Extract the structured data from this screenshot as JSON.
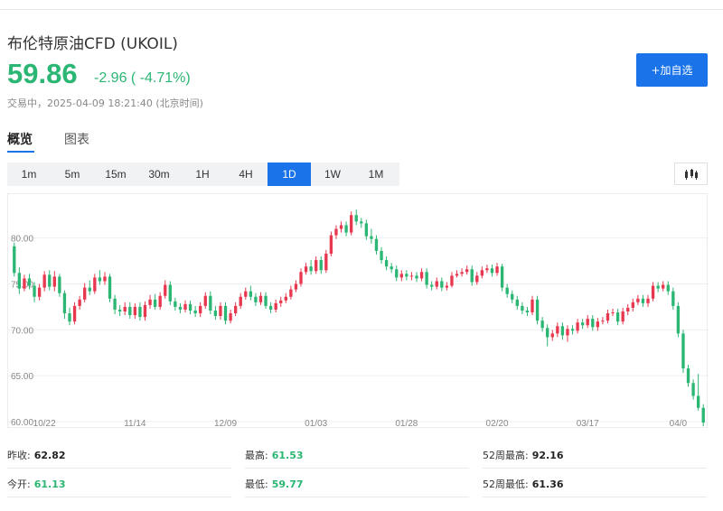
{
  "header": {
    "title": "布伦特原油CFD (UKOIL)",
    "price": "59.86",
    "change": "-2.96 ( -4.71%)",
    "status": "交易中，2025-04-09 18:21:40 (北京时间)",
    "add_watchlist": "+加自选"
  },
  "tabs": [
    {
      "label": "概览",
      "active": true
    },
    {
      "label": "图表",
      "active": false
    }
  ],
  "ranges": [
    {
      "label": "1m",
      "active": false
    },
    {
      "label": "5m",
      "active": false
    },
    {
      "label": "15m",
      "active": false
    },
    {
      "label": "30m",
      "active": false
    },
    {
      "label": "1H",
      "active": false
    },
    {
      "label": "4H",
      "active": false
    },
    {
      "label": "1D",
      "active": true
    },
    {
      "label": "1W",
      "active": false
    },
    {
      "label": "1M",
      "active": false
    }
  ],
  "chart_type_icon": "candlestick-icon",
  "chart_data": {
    "type": "candlestick",
    "ylim": [
      60,
      84
    ],
    "y_ticks": [
      "80.00",
      "75.00",
      "70.00",
      "65.00",
      "60.00"
    ],
    "y_tick_values": [
      80,
      75,
      70,
      65,
      60
    ],
    "x_labels": [
      "10/22",
      "11/14",
      "12/09",
      "01/03",
      "01/28",
      "02/20",
      "03/17",
      "04/0"
    ],
    "x_label_index": [
      6,
      24,
      42,
      60,
      78,
      96,
      114,
      132
    ],
    "up_color": "#e8384f",
    "down_color": "#2bb673",
    "candles": [
      [
        79.1,
        76.2,
        79.5,
        75.8
      ],
      [
        76.2,
        74.5,
        76.8,
        73.9
      ],
      [
        74.5,
        75.6,
        76.0,
        74.2
      ],
      [
        75.6,
        74.8,
        76.1,
        74.4
      ],
      [
        74.8,
        73.6,
        75.2,
        73.0
      ],
      [
        73.6,
        74.6,
        75.0,
        73.2
      ],
      [
        74.6,
        76.0,
        76.4,
        74.2
      ],
      [
        76.0,
        74.7,
        76.5,
        74.3
      ],
      [
        74.7,
        75.8,
        76.4,
        74.2
      ],
      [
        75.8,
        74.0,
        76.1,
        73.6
      ],
      [
        74.0,
        71.8,
        74.3,
        71.2
      ],
      [
        71.8,
        70.9,
        72.4,
        70.5
      ],
      [
        70.9,
        72.6,
        73.0,
        70.6
      ],
      [
        72.6,
        73.3,
        73.7,
        72.2
      ],
      [
        73.3,
        74.6,
        75.1,
        73.0
      ],
      [
        74.6,
        74.2,
        75.4,
        73.8
      ],
      [
        74.2,
        75.7,
        76.1,
        73.9
      ],
      [
        75.7,
        75.3,
        76.5,
        74.9
      ],
      [
        75.3,
        75.8,
        76.3,
        74.9
      ],
      [
        75.8,
        73.4,
        76.1,
        73.0
      ],
      [
        73.4,
        72.2,
        73.8,
        71.7
      ],
      [
        72.2,
        72.0,
        72.7,
        71.5
      ],
      [
        72.0,
        72.5,
        73.0,
        71.6
      ],
      [
        72.5,
        71.6,
        73.0,
        71.2
      ],
      [
        71.6,
        72.5,
        72.9,
        71.2
      ],
      [
        72.5,
        71.4,
        73.0,
        71.0
      ],
      [
        71.4,
        72.7,
        73.1,
        71.0
      ],
      [
        72.7,
        73.3,
        73.8,
        72.3
      ],
      [
        73.3,
        72.5,
        73.9,
        72.2
      ],
      [
        72.5,
        73.7,
        74.1,
        72.2
      ],
      [
        73.7,
        74.9,
        75.4,
        73.4
      ],
      [
        74.9,
        73.1,
        75.3,
        72.7
      ],
      [
        73.1,
        72.5,
        73.5,
        72.1
      ],
      [
        72.5,
        72.2,
        72.9,
        71.8
      ],
      [
        72.2,
        72.8,
        73.2,
        71.9
      ],
      [
        72.8,
        72.1,
        73.2,
        71.7
      ],
      [
        72.1,
        71.8,
        72.6,
        71.4
      ],
      [
        71.8,
        72.6,
        73.0,
        71.4
      ],
      [
        72.6,
        73.7,
        74.1,
        72.3
      ],
      [
        73.7,
        72.1,
        74.2,
        71.7
      ],
      [
        72.1,
        71.5,
        72.6,
        71.1
      ],
      [
        71.5,
        72.6,
        73.0,
        71.1
      ],
      [
        72.6,
        71.0,
        73.0,
        70.6
      ],
      [
        71.0,
        71.8,
        72.2,
        70.7
      ],
      [
        71.8,
        72.6,
        73.0,
        71.5
      ],
      [
        72.6,
        73.6,
        74.0,
        72.3
      ],
      [
        73.6,
        74.2,
        74.6,
        73.3
      ],
      [
        74.2,
        73.6,
        74.8,
        73.2
      ],
      [
        73.6,
        73.0,
        74.0,
        72.6
      ],
      [
        73.0,
        73.7,
        74.1,
        72.7
      ],
      [
        73.7,
        72.6,
        74.1,
        72.3
      ],
      [
        72.6,
        72.2,
        73.0,
        71.8
      ],
      [
        72.2,
        72.9,
        73.3,
        71.9
      ],
      [
        72.9,
        73.2,
        73.6,
        72.5
      ],
      [
        73.2,
        73.6,
        74.0,
        72.9
      ],
      [
        73.6,
        74.4,
        74.8,
        73.3
      ],
      [
        74.4,
        75.0,
        75.4,
        74.1
      ],
      [
        75.0,
        76.3,
        76.7,
        74.7
      ],
      [
        76.3,
        76.9,
        77.3,
        76.0
      ],
      [
        76.9,
        76.4,
        77.6,
        76.0
      ],
      [
        76.4,
        77.6,
        78.0,
        76.1
      ],
      [
        77.6,
        76.5,
        78.0,
        76.1
      ],
      [
        76.5,
        78.3,
        78.7,
        76.2
      ],
      [
        78.3,
        80.3,
        80.7,
        78.0
      ],
      [
        80.3,
        81.0,
        81.4,
        79.9
      ],
      [
        81.0,
        81.4,
        81.8,
        80.6
      ],
      [
        81.4,
        80.6,
        81.8,
        80.2
      ],
      [
        80.6,
        82.5,
        82.9,
        80.3
      ],
      [
        82.5,
        81.8,
        83.1,
        81.4
      ],
      [
        81.8,
        81.6,
        82.2,
        81.1
      ],
      [
        81.6,
        80.2,
        82.0,
        79.8
      ],
      [
        80.2,
        79.9,
        81.0,
        79.4
      ],
      [
        79.9,
        78.6,
        80.3,
        78.2
      ],
      [
        78.6,
        77.6,
        79.0,
        77.2
      ],
      [
        77.6,
        76.9,
        78.0,
        76.5
      ],
      [
        76.9,
        76.6,
        77.3,
        76.2
      ],
      [
        76.6,
        75.7,
        77.0,
        75.3
      ],
      [
        75.7,
        76.1,
        76.5,
        75.3
      ],
      [
        76.1,
        75.8,
        76.5,
        75.4
      ],
      [
        75.8,
        75.9,
        76.3,
        75.4
      ],
      [
        75.9,
        75.6,
        76.3,
        75.2
      ],
      [
        75.6,
        76.3,
        76.7,
        75.3
      ],
      [
        76.3,
        74.9,
        76.7,
        74.5
      ],
      [
        74.9,
        74.7,
        75.3,
        74.3
      ],
      [
        74.7,
        75.3,
        75.7,
        74.4
      ],
      [
        75.3,
        74.6,
        75.7,
        74.2
      ],
      [
        74.6,
        74.8,
        75.2,
        74.3
      ],
      [
        74.8,
        75.9,
        76.3,
        74.6
      ],
      [
        75.9,
        76.1,
        76.5,
        75.7
      ],
      [
        76.1,
        76.3,
        76.7,
        75.8
      ],
      [
        76.3,
        76.6,
        77.0,
        76.0
      ],
      [
        76.6,
        75.2,
        77.0,
        74.8
      ],
      [
        75.2,
        75.9,
        76.3,
        74.9
      ],
      [
        75.9,
        76.5,
        76.9,
        75.6
      ],
      [
        76.5,
        76.7,
        77.1,
        76.2
      ],
      [
        76.7,
        76.2,
        77.1,
        75.8
      ],
      [
        76.2,
        76.9,
        77.3,
        75.9
      ],
      [
        76.9,
        74.6,
        77.2,
        74.2
      ],
      [
        74.6,
        73.9,
        75.0,
        73.5
      ],
      [
        73.9,
        73.3,
        74.3,
        72.9
      ],
      [
        73.3,
        72.6,
        73.7,
        72.2
      ],
      [
        72.6,
        72.1,
        73.0,
        71.7
      ],
      [
        72.1,
        71.9,
        72.5,
        71.5
      ],
      [
        71.9,
        73.3,
        73.7,
        71.6
      ],
      [
        73.3,
        71.0,
        73.7,
        70.6
      ],
      [
        71.0,
        70.2,
        71.4,
        69.8
      ],
      [
        70.2,
        69.2,
        70.6,
        68.2
      ],
      [
        69.2,
        69.6,
        70.0,
        68.8
      ],
      [
        69.6,
        70.4,
        70.8,
        69.2
      ],
      [
        70.4,
        69.4,
        70.8,
        68.9
      ],
      [
        69.4,
        70.1,
        70.5,
        68.7
      ],
      [
        70.1,
        69.9,
        70.5,
        69.5
      ],
      [
        69.9,
        70.8,
        71.2,
        69.6
      ],
      [
        70.8,
        70.5,
        71.2,
        70.1
      ],
      [
        70.5,
        71.2,
        71.6,
        70.2
      ],
      [
        71.2,
        70.3,
        71.6,
        69.9
      ],
      [
        70.3,
        70.9,
        71.3,
        69.9
      ],
      [
        70.9,
        71.0,
        71.4,
        70.6
      ],
      [
        71.0,
        71.8,
        72.2,
        70.7
      ],
      [
        71.8,
        71.9,
        72.3,
        71.5
      ],
      [
        71.9,
        70.9,
        72.3,
        70.5
      ],
      [
        70.9,
        72.0,
        72.4,
        70.6
      ],
      [
        72.0,
        72.4,
        72.8,
        71.6
      ],
      [
        72.4,
        73.0,
        73.4,
        72.0
      ],
      [
        73.0,
        73.4,
        73.8,
        72.7
      ],
      [
        73.4,
        72.9,
        73.8,
        72.5
      ],
      [
        72.9,
        73.4,
        73.8,
        72.5
      ],
      [
        73.4,
        74.8,
        75.2,
        73.1
      ],
      [
        74.8,
        74.5,
        75.2,
        74.1
      ],
      [
        74.5,
        74.9,
        75.3,
        74.2
      ],
      [
        74.9,
        74.2,
        75.3,
        73.8
      ],
      [
        74.2,
        72.6,
        74.6,
        72.2
      ],
      [
        72.6,
        69.6,
        73.0,
        69.2
      ],
      [
        69.6,
        65.8,
        70.0,
        65.3
      ],
      [
        65.8,
        64.2,
        66.2,
        63.8
      ],
      [
        64.2,
        62.8,
        64.6,
        62.4
      ],
      [
        62.8,
        61.5,
        65.2,
        61.2
      ],
      [
        61.5,
        59.9,
        61.9,
        59.5
      ]
    ]
  },
  "stats": [
    [
      {
        "label": "昨收:",
        "value": "62.82",
        "color": "dark"
      },
      {
        "label": "最高:",
        "value": "61.53",
        "color": "green"
      },
      {
        "label": "52周最高:",
        "value": "92.16",
        "color": "dark"
      }
    ],
    [
      {
        "label": "今开:",
        "value": "61.13",
        "color": "green"
      },
      {
        "label": "最低:",
        "value": "59.77",
        "color": "green"
      },
      {
        "label": "52周最低:",
        "value": "61.36",
        "color": "dark"
      }
    ]
  ]
}
